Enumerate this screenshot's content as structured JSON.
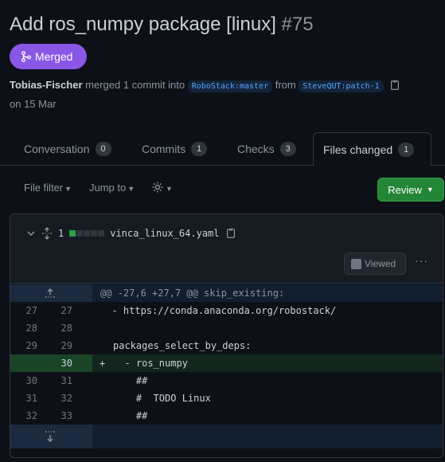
{
  "pr": {
    "title": "Add ros_numpy package [linux]",
    "number": "#75",
    "state": "Merged",
    "author": "Tobias-Fischer",
    "action_text": "merged 1 commit into",
    "base_branch": "RoboStack:master",
    "from_text": "from",
    "head_branch": "SteveQUT:patch-1",
    "date_text": "on 15 Mar"
  },
  "tabs": [
    {
      "label": "Conversation",
      "count": "0"
    },
    {
      "label": "Commits",
      "count": "1"
    },
    {
      "label": "Checks",
      "count": "3"
    },
    {
      "label": "Files changed",
      "count": "1"
    }
  ],
  "toolbar": {
    "file_filter": "File filter",
    "jump_to": "Jump to",
    "review": "Review"
  },
  "file": {
    "changes": "1",
    "name": "vinca_linux_64.yaml",
    "viewed_label": "Viewed"
  },
  "diff": {
    "hunk": "@@ -27,6 +27,7 @@ skip_existing:",
    "lines": [
      {
        "old": "27",
        "new": "27",
        "code": "  - https://conda.anaconda.org/robostack/"
      },
      {
        "old": "28",
        "new": "28",
        "code": ""
      },
      {
        "old": "29",
        "new": "29",
        "code": "packages_select_by_deps:"
      },
      {
        "old": "",
        "new": "30",
        "sign": "+",
        "code": "  - ros_numpy"
      },
      {
        "old": "30",
        "new": "31",
        "code": "    ##"
      },
      {
        "old": "31",
        "new": "32",
        "code": "    #  TODO Linux"
      },
      {
        "old": "32",
        "new": "33",
        "code": "    ##"
      }
    ]
  },
  "colors": {
    "merged": "#8957e5",
    "review": "#238636",
    "addition": "#2ea043"
  }
}
